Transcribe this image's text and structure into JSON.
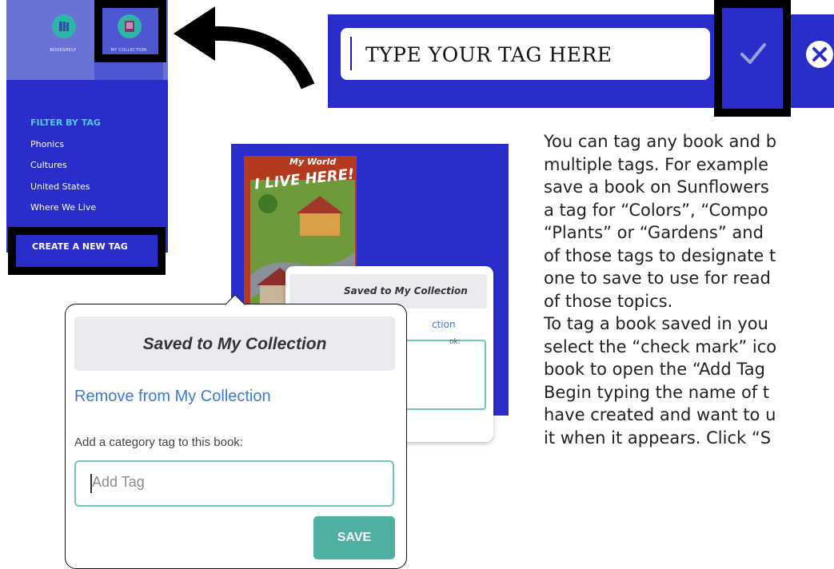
{
  "sidebar": {
    "tabs": [
      {
        "label": "BOOKSHELF",
        "icon": "bookshelf-icon",
        "color": "#2fb5a8"
      },
      {
        "label": "MY COLLECTION",
        "icon": "my-collection-icon",
        "color": "#2fb5a8"
      }
    ],
    "filter_heading": "FILTER BY TAG",
    "tags": [
      "Phonics",
      "Cultures",
      "United States",
      "Where We Live"
    ],
    "create_tag": "CREATE A NEW TAG"
  },
  "tag_bar": {
    "input_text": "TYPE YOUR TAG HERE",
    "confirm_icon": "check-icon",
    "close_icon": "close-icon"
  },
  "book": {
    "series": "My World",
    "title": "I LIVE HERE!"
  },
  "small_popup": {
    "saved": "Saved to My Collection",
    "remove_partial": "ction",
    "add_tag_partial": "ok:"
  },
  "big_popup": {
    "saved": "Saved to My Collection",
    "remove": "Remove from My Collection",
    "add_tag_label": "Add a category tag to this book:",
    "input_placeholder": "Add Tag",
    "save": "SAVE"
  },
  "instructions": [
    "You can tag any book and b",
    "multiple tags.  For example",
    "save a book on Sunflowers",
    "a tag for “Colors”, “Compo",
    "“Plants” or “Gardens” and",
    "of those tags to designate t",
    "one to save to use for read",
    "of those topics.",
    "To tag a book saved in you",
    "select the “check mark” ico",
    "book to open the “Add Tag",
    "Begin typing the name of t",
    "have created and want to u",
    "it when it appears.  Click “S"
  ],
  "colors": {
    "blue": "#2a2dc9",
    "teal": "#4fb0a2",
    "link": "#3b7bcf"
  }
}
